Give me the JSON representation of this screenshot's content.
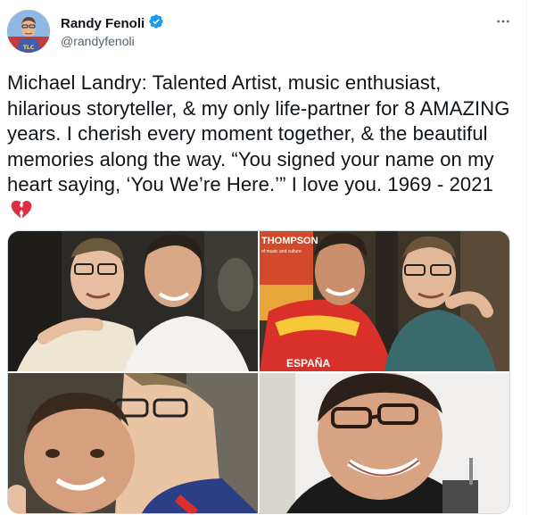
{
  "author": {
    "display_name": "Randy Fenoli",
    "handle": "@randyfenoli",
    "verified": true,
    "avatar_icon": "avatar-photo"
  },
  "tweet": {
    "text": "Michael Landry: Talented Artist, music enthusiast, hilarious storyteller, & my only life-partner for 8 AMAZING years. I cherish every moment together, & the beautiful memories along the way. “You signed your name on my heart saying, ‘You We’re Here.’” I love you. 1969 - 2021",
    "emoji_icon": "broken-heart-icon"
  },
  "media": {
    "photos": [
      {
        "name": "photo-two-men-dark-background"
      },
      {
        "name": "photo-two-men-thompson-sign",
        "sign_text": "THOMPSON",
        "sub_sign_text": "of music and culture",
        "jersey_text": "ESPAÑA"
      },
      {
        "name": "photo-two-men-closeup"
      },
      {
        "name": "photo-man-with-glasses-smiling"
      }
    ]
  },
  "colors": {
    "verified_blue": "#1d9bf0",
    "text_primary": "#0f1419",
    "text_secondary": "#536471",
    "border": "#cfd9de",
    "broken_heart": "#dd2e44"
  },
  "icons": {
    "more": "more-options-icon",
    "verified": "verified-badge-icon"
  }
}
